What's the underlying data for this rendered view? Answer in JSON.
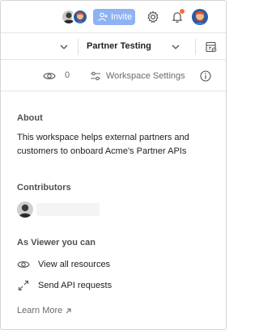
{
  "header": {
    "invite_label": "Invite",
    "icons": [
      "contributor-avatar",
      "contributor-avatar",
      "add-person-icon",
      "gear-icon",
      "bell-icon",
      "user-avatar"
    ],
    "accent": "#8fb2f3",
    "notification_color": "#ff6c37"
  },
  "environment": {
    "selected": "Partner Testing"
  },
  "workspace_bar": {
    "watch_count": "0",
    "settings_label": "Workspace Settings"
  },
  "about": {
    "heading": "About",
    "description": "This workspace helps external partners and customers to onboard Acme's Partner APIs"
  },
  "contributors": {
    "heading": "Contributors"
  },
  "viewer": {
    "heading": "As Viewer you can",
    "permissions": [
      {
        "label": "View all resources",
        "icon": "eye-icon"
      },
      {
        "label": "Send API requests",
        "icon": "send-request-icon"
      }
    ]
  },
  "learn_more": {
    "label": "Learn More",
    "icon": "external-arrow-icon"
  }
}
